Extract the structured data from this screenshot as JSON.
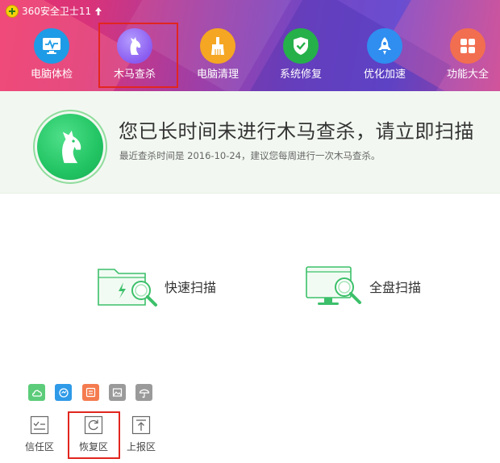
{
  "app": {
    "title": "360安全卫士11",
    "logo_icon": "360-logo-icon",
    "upgrade_icon": "up-arrow-icon"
  },
  "nav": {
    "items": [
      {
        "label": "电脑体检",
        "icon": "monitor-pulse-icon",
        "color": "#1e9be6"
      },
      {
        "label": "木马查杀",
        "icon": "horse-icon",
        "color": "#8a5cf0",
        "selected": true
      },
      {
        "label": "电脑清理",
        "icon": "broom-icon",
        "color": "#f5a623"
      },
      {
        "label": "系统修复",
        "icon": "shield-check-icon",
        "color": "#26b04a"
      },
      {
        "label": "优化加速",
        "icon": "rocket-icon",
        "color": "#2f8ef0"
      },
      {
        "label": "功能大全",
        "icon": "grid-icon",
        "color": "#f26e50"
      }
    ]
  },
  "banner": {
    "icon": "horse-icon",
    "headline": "您已长时间未进行木马查杀，请立即扫描",
    "subtext": "最近查杀时间是 2016-10-24，建议您每周进行一次木马查杀。",
    "accent": "#22c463"
  },
  "scan": {
    "quick_label": "快速扫描",
    "quick_icon": "folder-magnifier-icon",
    "full_label": "全盘扫描",
    "full_icon": "monitor-magnifier-icon",
    "icon_color": "#3cc06a"
  },
  "tools": {
    "mini": [
      {
        "icon": "cloud-icon",
        "color": "#5ccc7a"
      },
      {
        "icon": "refresh-circle-icon",
        "color": "#2f9ae8"
      },
      {
        "icon": "document-list-icon",
        "color": "#f47b4f"
      },
      {
        "icon": "image-icon",
        "color": "#9a9a9a"
      },
      {
        "icon": "umbrella-icon",
        "color": "#9a9a9a"
      }
    ],
    "areas": [
      {
        "label": "信任区",
        "icon": "checklist-icon"
      },
      {
        "label": "恢复区",
        "icon": "restore-icon",
        "highlighted": true
      },
      {
        "label": "上报区",
        "icon": "upload-icon"
      }
    ]
  }
}
